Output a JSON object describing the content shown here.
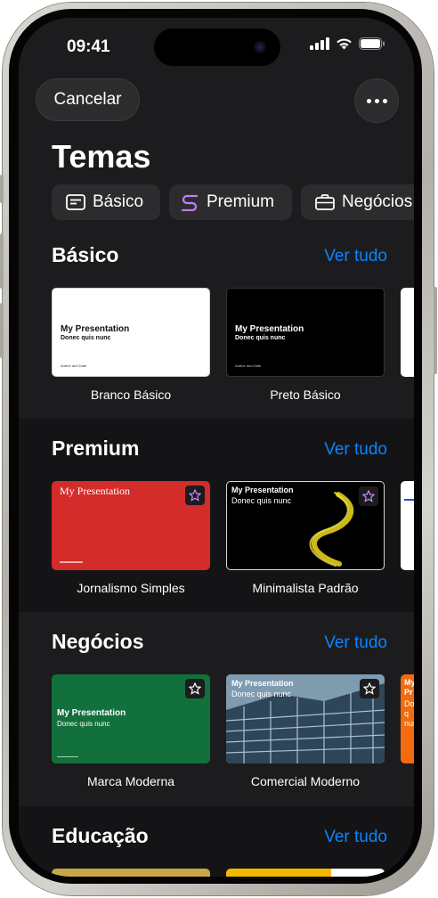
{
  "status_bar": {
    "time": "09:41",
    "icons": [
      "cellular-signal-icon",
      "wifi-icon",
      "battery-icon"
    ]
  },
  "header": {
    "cancel_label": "Cancelar",
    "more_icon": "ellipsis-icon",
    "title": "Temas"
  },
  "filters": [
    {
      "label": "Básico",
      "icon": "presentation-icon"
    },
    {
      "label": "Premium",
      "icon": "premium-swirl-icon"
    },
    {
      "label": "Negócios",
      "icon": "briefcase-icon"
    }
  ],
  "sections": [
    {
      "title": "Básico",
      "see_all": "Ver tudo",
      "themes": [
        {
          "name": "Branco Básico",
          "thumb_title": "My Presentation",
          "thumb_subtitle": "Donec quis nunc",
          "thumb_footer": "Author and Date"
        },
        {
          "name": "Preto Básico",
          "thumb_title": "My Presentation",
          "thumb_subtitle": "Donec quis nunc",
          "thumb_footer": "Author and Date"
        }
      ]
    },
    {
      "title": "Premium",
      "see_all": "Ver tudo",
      "themes": [
        {
          "name": "Jornalismo Simples",
          "thumb_title": "My Presentation"
        },
        {
          "name": "Minimalista Padrão",
          "thumb_title": "My Presentation",
          "thumb_subtitle": "Donec quis nunc"
        }
      ]
    },
    {
      "title": "Negócios",
      "see_all": "Ver tudo",
      "themes": [
        {
          "name": "Marca Moderna",
          "thumb_title": "My Presentation",
          "thumb_subtitle": "Donec quis nunc"
        },
        {
          "name": "Comercial Moderno",
          "thumb_title": "My Presentation",
          "thumb_subtitle": "Donec quis nunc"
        }
      ],
      "peek_card": {
        "thumb_title": "My Pr",
        "thumb_subtitle": "Donec q nunc"
      }
    },
    {
      "title": "Educação",
      "see_all": "Ver tudo"
    }
  ],
  "colors": {
    "background": "#1c1c1e",
    "accent": "#0a84ff",
    "chip_background": "#2c2c2e",
    "premium_red": "#d42b2b",
    "business_green": "#11703c",
    "business_orange": "#f26b0f"
  }
}
